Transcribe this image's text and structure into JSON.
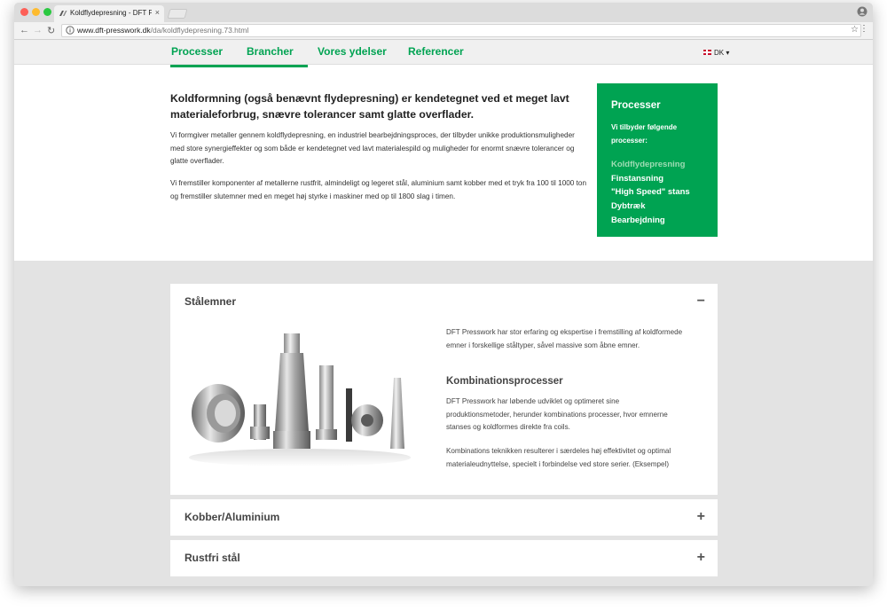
{
  "browser": {
    "tab_title": "Koldflydepresning - DFT Presswork",
    "tab_close": "×",
    "url_host": "www.dft-presswork.dk",
    "url_path": "/da/koldflydepresning.73.html",
    "back": "←",
    "forward": "→",
    "reload": "↻",
    "star": "☆",
    "menu": "⋮"
  },
  "nav": {
    "items": [
      "Processer",
      "Brancher",
      "Vores ydelser",
      "Referencer"
    ],
    "language": "DK",
    "language_caret": "▾",
    "accent_color": "#00a352"
  },
  "intro": {
    "heading": "Koldformning (også benævnt flydepresning) er kendetegnet ved et meget lavt materialeforbrug, snævre tolerancer samt glatte overflader.",
    "paragraph1": "Vi formgiver metaller gennem koldflydepresning, en industriel bearbejdningsproces, der tilbyder unikke produktionsmuligheder med store synergieffekter og som både er kendetegnet ved lavt materialespild og muligheder for enormt snævre tolerancer og glatte overflader.",
    "paragraph2": "Vi fremstiller komponenter af metallerne rustfrit, almindeligt og legeret stål, aluminium samt kobber med et tryk fra 100 til 1000 ton og fremstiller slutemner med en meget høj styrke i maskiner med  op til 1800 slag i timen."
  },
  "sidebar": {
    "title": "Processer",
    "subtitle": "Vi tilbyder følgende processer:",
    "items": [
      "Koldflydepresning",
      "Finstansning",
      "\"High Speed\" stans",
      "Dybtræk",
      "Bearbejdning"
    ],
    "active_index": 0,
    "bg_color": "#00a352"
  },
  "accordion": {
    "panels": [
      {
        "title": "Stålemner",
        "toggle": "−",
        "expanded": true,
        "text1": "DFT Presswork har stor erfaring og ekspertise i fremstilling af koldformede emner i forskellige ståltyper, såvel massive som åbne emner.",
        "subheading": "Kombinationsprocesser",
        "text2": "DFT Presswork har løbende udviklet og optimeret sine produktionsmetoder, herunder kombinations processer, hvor emnerne stanses og koldformes direkte fra coils.",
        "text3": "Kombinations teknikken resulterer i særdeles høj effektivitet og optimal materialeudnyttelse, specielt i forbindelse ved store serier. (Eksempel)"
      },
      {
        "title": "Kobber/Aluminium",
        "toggle": "+",
        "expanded": false
      },
      {
        "title": "Rustfri stål",
        "toggle": "+",
        "expanded": false
      }
    ]
  }
}
